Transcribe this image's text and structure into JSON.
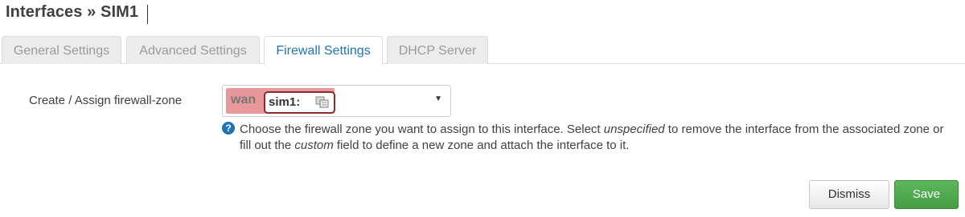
{
  "page": {
    "title": "Interfaces » SIM1"
  },
  "tabs": [
    {
      "label": "General Settings",
      "active": false
    },
    {
      "label": "Advanced Settings",
      "active": false
    },
    {
      "label": "Firewall Settings",
      "active": true
    },
    {
      "label": "DHCP Server",
      "active": false
    }
  ],
  "firewall": {
    "field_label": "Create / Assign firewall-zone",
    "zone_name": "wan",
    "zone_interface": "sim1:",
    "zone_color": "#e8989a",
    "help_part1": "Choose the firewall zone you want to assign to this interface. Select ",
    "help_em1": "unspecified",
    "help_part2": " to remove the interface from the associated zone or fill out the ",
    "help_em2": "custom",
    "help_part3": " field to define a new zone and attach the interface to it."
  },
  "buttons": {
    "dismiss": "Dismiss",
    "save": "Save"
  },
  "colors": {
    "accent": "#1f74b9",
    "save": "#5cb85c"
  }
}
